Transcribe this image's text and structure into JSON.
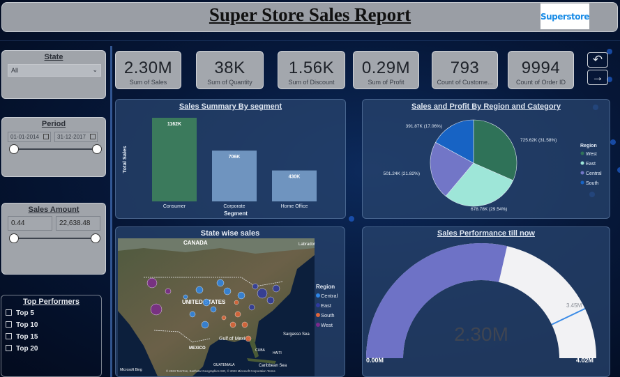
{
  "header": {
    "title": "Super Store Sales Report",
    "logo_text": "Superstore"
  },
  "slicers": {
    "state": {
      "title": "State",
      "value": "All"
    },
    "period": {
      "title": "Period",
      "start": "01-01-2014",
      "end": "31-12-2017"
    },
    "sales_amount": {
      "title": "Sales Amount",
      "min": "0.44",
      "max": "22,638.48"
    },
    "top_performers": {
      "title": "Top Performers",
      "options": [
        "Top 5",
        "Top 10",
        "Top 15",
        "Top 20"
      ]
    }
  },
  "kpis": [
    {
      "value": "2.30M",
      "label": "Sum of Sales"
    },
    {
      "value": "38K",
      "label": "Sum of Quantity"
    },
    {
      "value": "1.56K",
      "label": "Sum of Discount"
    },
    {
      "value": "0.29M",
      "label": "Sum of Profit"
    },
    {
      "value": "793",
      "label": "Count of Custome..."
    },
    {
      "value": "9994",
      "label": "Count of Order ID"
    }
  ],
  "nav": {
    "back_icon": "back-arrow-icon",
    "forward_icon": "forward-arrow-icon"
  },
  "colors": {
    "bar_consumer": "#3b7a5c",
    "bar_other": "#6f94bf",
    "west": "#2f7258",
    "east": "#9ee6d8",
    "central": "#7276c7",
    "south": "#1763c4"
  },
  "charts": {
    "segment_title": "Sales Summary By segment",
    "pie_title": "Sales and Profit By Region and Category",
    "map_title": "State wise sales",
    "gauge_title": "Sales Performance till now"
  },
  "chart_data": [
    {
      "type": "bar",
      "title": "Sales Summary By segment",
      "xlabel": "Segment",
      "ylabel": "Total Sales",
      "categories": [
        "Consumer",
        "Corporate",
        "Home Office"
      ],
      "values": [
        1162,
        706,
        430
      ],
      "labels": [
        "1162K",
        "706K",
        "430K"
      ]
    },
    {
      "type": "pie",
      "title": "Sales and Profit By Region and Category",
      "legend_title": "Region",
      "categories": [
        "West",
        "East",
        "Central",
        "South"
      ],
      "values": [
        725.62,
        678.78,
        501.24,
        391.87
      ],
      "labels": [
        "725.62K (31.58%)",
        "678.78K (29.54%)",
        "501.24K (21.82%)",
        "391.87K (17.06%)"
      ]
    },
    {
      "type": "gauge",
      "title": "Sales Performance till now",
      "value": 2.3,
      "min": 0,
      "max": 4.02,
      "target": 3.45,
      "value_label": "2.30M",
      "min_label": "0.00M",
      "max_label": "4.02M",
      "target_label": "3.45M"
    }
  ],
  "map": {
    "legend_title": "Region",
    "legend": [
      "Central",
      "East",
      "South",
      "West"
    ],
    "labels": [
      "CANADA",
      "UNITED STATES",
      "MEXICO",
      "Gulf of Mexico",
      "Sargasso Sea",
      "Caribbean Sea",
      "Labrador",
      "CUBA",
      "HAITI",
      "GUATEMALA"
    ],
    "attribution": "© 2023 TomTom, Earthstar Geographics SIO, © 2023 Microsoft Corporation  Terms",
    "provider": "Microsoft Bing"
  }
}
